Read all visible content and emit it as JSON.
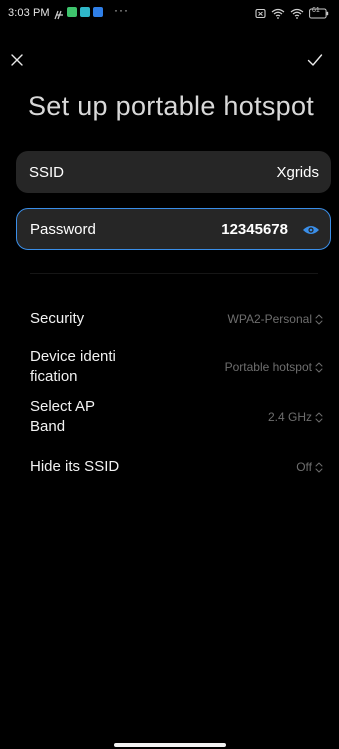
{
  "status_bar": {
    "time": "3:03 PM",
    "more": "···",
    "icons": [
      "nfc-icon",
      "app-icon-green",
      "app-icon-teal",
      "app-icon-blue",
      "sim-icon",
      "wifi-icon",
      "wifi-icon-2",
      "battery-icon"
    ],
    "battery_level": "61"
  },
  "header": {
    "title": "Set up portable hotspot"
  },
  "fields": {
    "ssid": {
      "label": "SSID",
      "value": "Xgrids"
    },
    "password": {
      "label": "Password",
      "value": "12345678"
    }
  },
  "settings": [
    {
      "label": "Security",
      "value": "WPA2-Personal"
    },
    {
      "label": "Device identi\nfication",
      "value": "Portable hotspot"
    },
    {
      "label": "Select AP\nBand",
      "value": "2.4 GHz"
    },
    {
      "label": "Hide its SSID",
      "value": "Off"
    }
  ],
  "colors": {
    "background": "#000000",
    "field_bg": "#262626",
    "accent": "#3a8ee8",
    "secondary_text": "#6e6e6e"
  }
}
